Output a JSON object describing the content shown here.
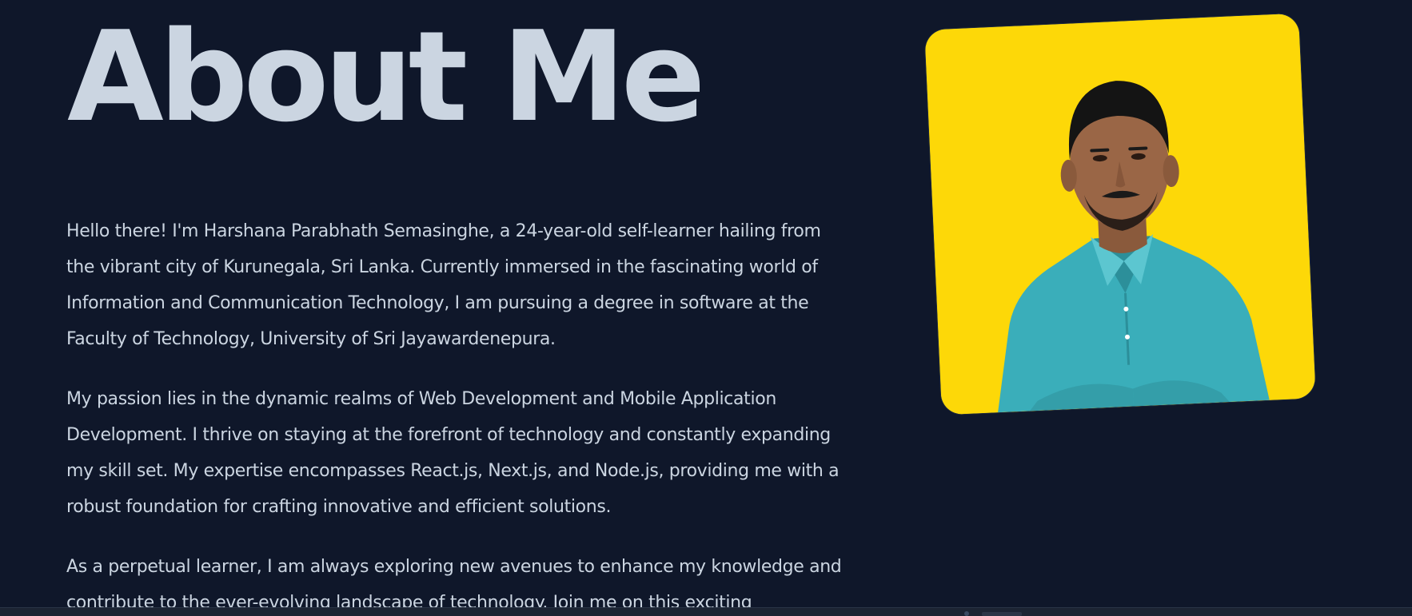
{
  "page": {
    "title": "About Me",
    "paragraphs": [
      "Hello there! I'm Harshana Parabhath Semasinghe, a 24-year-old self-learner hailing from the vibrant city of Kurunegala, Sri Lanka. Currently immersed in the fascinating world of Information and Communication Technology, I am pursuing a degree in software at the Faculty of Technology, University of Sri Jayawardenepura.",
      "My passion lies in the dynamic realms of Web Development and Mobile Application Development. I thrive on staying at the forefront of technology and constantly expanding my skill set. My expertise encompasses React.js, Next.js, and Node.js, providing me with a robust foundation for crafting innovative and efficient solutions.",
      "As a perpetual learner, I am always exploring new avenues to enhance my knowledge and contribute to the ever-evolving landscape of technology. Join me on this exciting"
    ]
  },
  "colors": {
    "background": "#0f172a",
    "text": "#cbd5e1",
    "photo_background": "#fdd808",
    "shirt": "#3aaeba"
  },
  "photo": {
    "icon": "profile-photo"
  }
}
